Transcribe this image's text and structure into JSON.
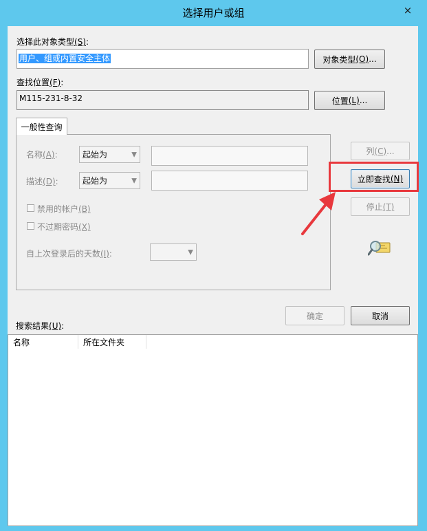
{
  "window": {
    "title": "选择用户或组",
    "close_icon": "×"
  },
  "object_type": {
    "label_text": "选择此对象类型",
    "label_hotkey": "(S)",
    "label_colon": ":",
    "value": "用户、组或内置安全主体",
    "button_text": "对象类型",
    "button_hotkey": "(O)",
    "button_ellipsis": "..."
  },
  "location": {
    "label_text": "查找位置",
    "label_hotkey": "(F)",
    "label_colon": ":",
    "value": "M115-231-8-32",
    "button_text": "位置",
    "button_hotkey": "(L)",
    "button_ellipsis": "..."
  },
  "general_query": {
    "tab_label": "一般性查询",
    "name_label": "名称",
    "name_hotkey": "(A)",
    "name_colon": ":",
    "name_operator": "起始为",
    "desc_label": "描述",
    "desc_hotkey": "(D)",
    "desc_colon": ":",
    "desc_operator": "起始为",
    "disabled_accounts_label": "禁用的帐户",
    "disabled_accounts_hotkey": "(B)",
    "non_expiring_label": "不过期密码",
    "non_expiring_hotkey": "(X)",
    "days_label": "自上次登录后的天数",
    "days_hotkey": "(I)",
    "days_colon": ":"
  },
  "side_buttons": {
    "columns_text": "列",
    "columns_hotkey": "(C)",
    "columns_ellipsis": "...",
    "find_now_text": "立即查找",
    "find_now_hotkey": "(N)",
    "stop_text": "停止",
    "stop_hotkey": "(T)"
  },
  "dialog_buttons": {
    "ok": "确定",
    "cancel": "取消"
  },
  "results": {
    "label_text": "搜索结果",
    "label_hotkey": "(U)",
    "label_colon": ":",
    "columns": [
      "名称",
      "所在文件夹"
    ]
  },
  "colors": {
    "accent": "#5ec8ed",
    "annotation": "#e8383d"
  }
}
